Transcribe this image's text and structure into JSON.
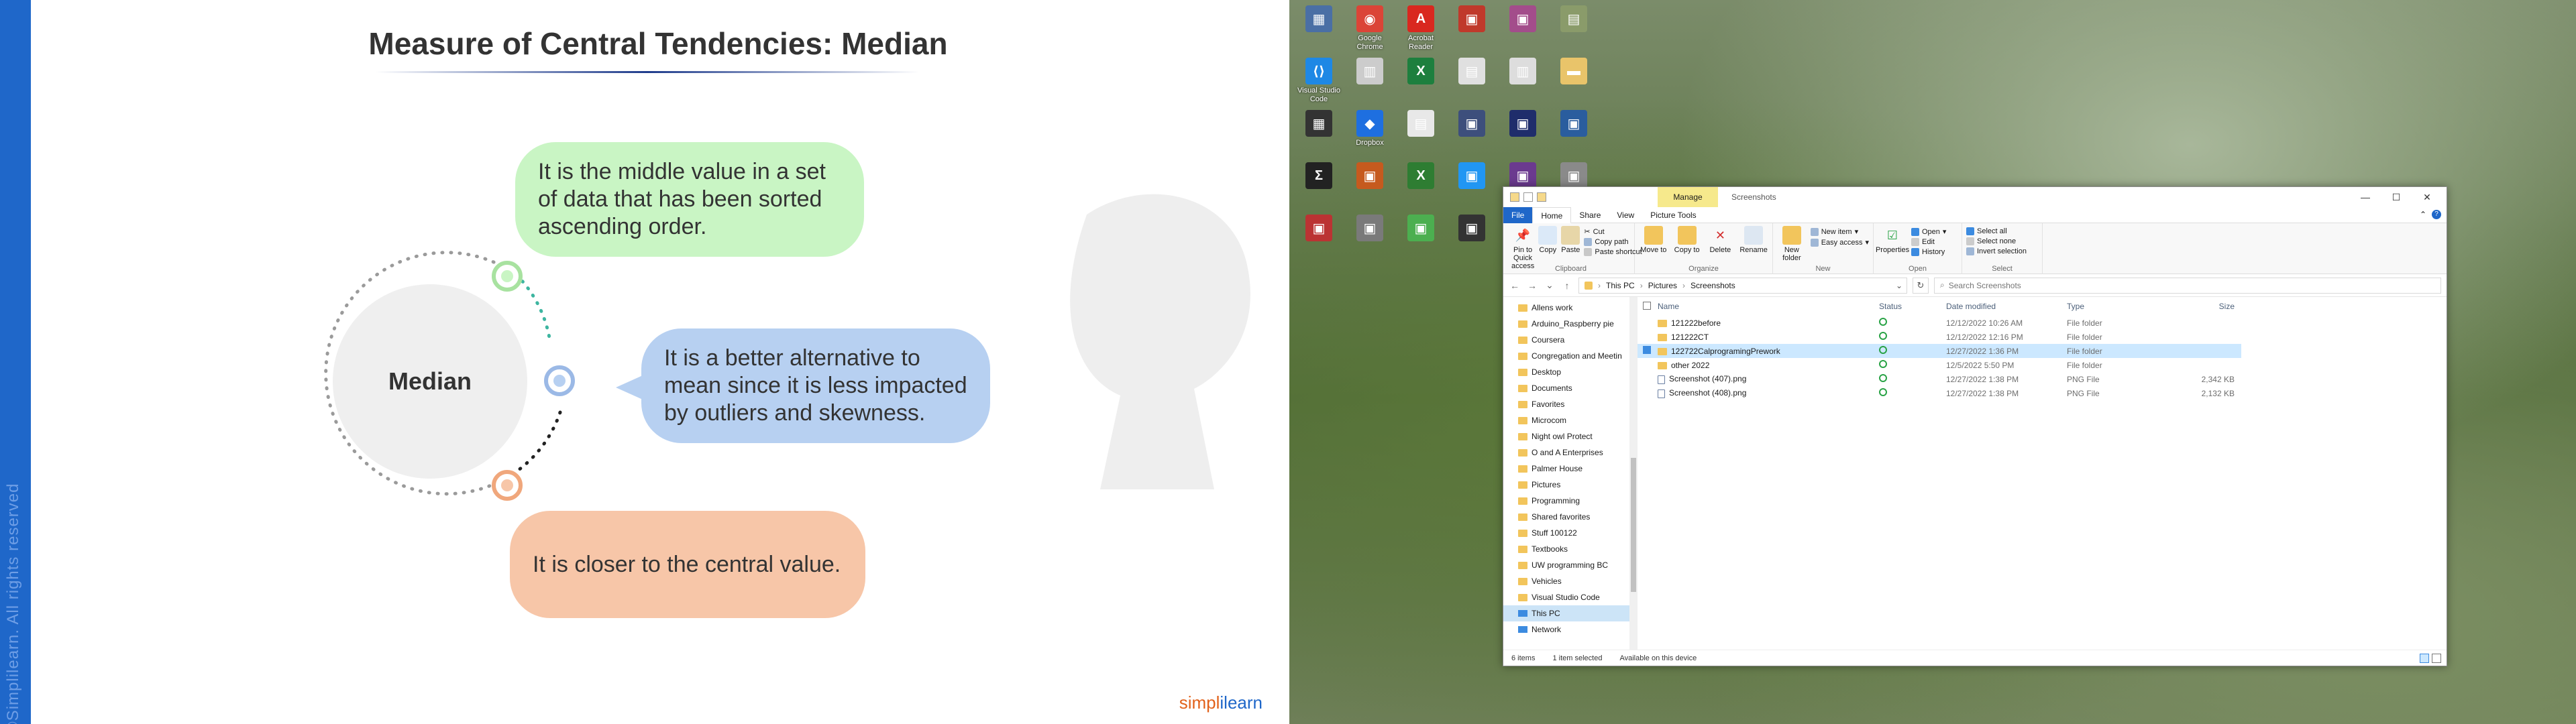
{
  "slide": {
    "title": "Measure of Central Tendencies: Median",
    "center_label": "Median",
    "bubble1": "It is the middle value in a set of data that has been sorted ascending order.",
    "bubble2": "It is a better alternative to mean since it is less impacted by outliers and skewness.",
    "bubble3": "It is closer to the central value.",
    "copyright": "©Simplilearn. All rights reserved",
    "brand_a": "simpl",
    "brand_b": "ilearn",
    "colors": {
      "sidebar": "#1f67c9",
      "green": "#c9f5c4",
      "blue": "#b7d0f1",
      "orange": "#f7c6a8"
    }
  },
  "desktop": {
    "icons": [
      {
        "label": "",
        "color": "#4a6fa5",
        "glyph": "▦"
      },
      {
        "label": "Google Chrome",
        "color": "#db4437",
        "glyph": "◉"
      },
      {
        "label": "Acrobat Reader",
        "color": "#d9281f",
        "glyph": "A"
      },
      {
        "label": "",
        "color": "#c0392b",
        "glyph": "▣"
      },
      {
        "label": "",
        "color": "#a34d8b",
        "glyph": "▣"
      },
      {
        "label": "",
        "color": "#8a9b6a",
        "glyph": "▤"
      },
      {
        "label": "Visual Studio Code",
        "color": "#1e88e5",
        "glyph": "⟨⟩"
      },
      {
        "label": "",
        "color": "#ccc",
        "glyph": "▥"
      },
      {
        "label": "",
        "color": "#1d7f3e",
        "glyph": "X"
      },
      {
        "label": "",
        "color": "#e0e0e0",
        "glyph": "▤"
      },
      {
        "label": "",
        "color": "#ddd",
        "glyph": "▥"
      },
      {
        "label": "",
        "color": "#e9c46a",
        "glyph": "▬"
      },
      {
        "label": "",
        "color": "#333",
        "glyph": "▦"
      },
      {
        "label": "Dropbox",
        "color": "#1e6fe0",
        "glyph": "◆"
      },
      {
        "label": "",
        "color": "#e8e8e8",
        "glyph": "▤"
      },
      {
        "label": "",
        "color": "#3d4f7c",
        "glyph": "▣"
      },
      {
        "label": "",
        "color": "#1f2d6b",
        "glyph": "▣"
      },
      {
        "label": "",
        "color": "#2a5d9e",
        "glyph": "▣"
      },
      {
        "label": "",
        "color": "#222",
        "glyph": "Σ"
      },
      {
        "label": "",
        "color": "#c65a1e",
        "glyph": "▣"
      },
      {
        "label": "",
        "color": "#2e7d32",
        "glyph": "X"
      },
      {
        "label": "",
        "color": "#2196f3",
        "glyph": "▣"
      },
      {
        "label": "",
        "color": "#6b3a8f",
        "glyph": "▣"
      },
      {
        "label": "",
        "color": "#8a8a8a",
        "glyph": "▣"
      },
      {
        "label": "",
        "color": "#b33",
        "glyph": "▣"
      },
      {
        "label": "",
        "color": "#7a7a7a",
        "glyph": "▣"
      },
      {
        "label": "",
        "color": "#4caf50",
        "glyph": "▣"
      },
      {
        "label": "",
        "color": "#333",
        "glyph": "▣"
      },
      {
        "label": "",
        "color": "#444",
        "glyph": "▣"
      },
      {
        "label": "",
        "color": "#ddd",
        "glyph": "▤"
      }
    ]
  },
  "explorer": {
    "manage_tab": "Manage",
    "title": "Screenshots",
    "window_buttons": {
      "min": "—",
      "max": "☐",
      "close": "✕"
    },
    "tabs": [
      "File",
      "Home",
      "Share",
      "View",
      "Picture Tools"
    ],
    "ribbon": {
      "clipboard": {
        "pin": "Pin to Quick access",
        "copy": "Copy",
        "paste": "Paste",
        "cut": "Cut",
        "copy_path": "Copy path",
        "paste_shortcut": "Paste shortcut",
        "label": "Clipboard"
      },
      "organize": {
        "move_to": "Move to",
        "copy_to": "Copy to",
        "delete": "Delete",
        "rename": "Rename",
        "label": "Organize"
      },
      "new": {
        "new_folder": "New folder",
        "new_item": "New item",
        "easy_access": "Easy access",
        "label": "New"
      },
      "open": {
        "properties": "Properties",
        "open": "Open",
        "edit": "Edit",
        "history": "History",
        "label": "Open"
      },
      "select": {
        "select_all": "Select all",
        "select_none": "Select none",
        "invert": "Invert selection",
        "label": "Select"
      }
    },
    "address": {
      "crumbs": [
        "This PC",
        "Pictures",
        "Screenshots"
      ]
    },
    "search_placeholder": "Search Screenshots",
    "nav": [
      "Allens work",
      "Arduino_Raspberry pie",
      "Coursera",
      "Congregation and Meetin",
      "Desktop",
      "Documents",
      "Favorites",
      "Microcom",
      "Night owl Protect",
      "O and A Enterprises",
      "Palmer House",
      "Pictures",
      "Programming",
      "Shared favorites",
      "Stuff 100122",
      "Textbooks",
      "UW programming BC",
      "Vehicles",
      "Visual Studio Code",
      "This PC",
      "Network"
    ],
    "columns": {
      "name": "Name",
      "status": "Status",
      "date": "Date modified",
      "type": "Type",
      "size": "Size"
    },
    "files": [
      {
        "name": "121222before",
        "date": "12/12/2022 10:26 AM",
        "type": "File folder",
        "size": "",
        "kind": "folder",
        "selected": false
      },
      {
        "name": "121222CT",
        "date": "12/12/2022 12:16 PM",
        "type": "File folder",
        "size": "",
        "kind": "folder",
        "selected": false
      },
      {
        "name": "122722CalprogramingPrework",
        "date": "12/27/2022 1:36 PM",
        "type": "File folder",
        "size": "",
        "kind": "folder",
        "selected": true
      },
      {
        "name": "other 2022",
        "date": "12/5/2022 5:50 PM",
        "type": "File folder",
        "size": "",
        "kind": "folder",
        "selected": false
      },
      {
        "name": "Screenshot (407).png",
        "date": "12/27/2022 1:38 PM",
        "type": "PNG File",
        "size": "2,342 KB",
        "kind": "png",
        "selected": false
      },
      {
        "name": "Screenshot (408).png",
        "date": "12/27/2022 1:38 PM",
        "type": "PNG File",
        "size": "2,132 KB",
        "kind": "png",
        "selected": false
      }
    ],
    "status": {
      "items": "6 items",
      "selected": "1 item selected",
      "availability": "Available on this device"
    }
  }
}
